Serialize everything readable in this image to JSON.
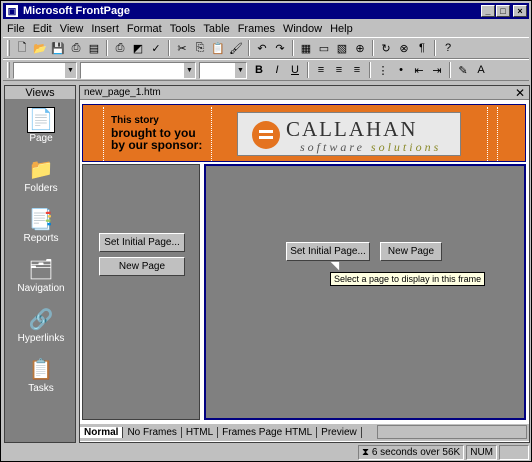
{
  "window": {
    "title": "Microsoft FrontPage"
  },
  "menu": [
    "File",
    "Edit",
    "View",
    "Insert",
    "Format",
    "Tools",
    "Table",
    "Frames",
    "Window",
    "Help"
  ],
  "views": {
    "header": "Views",
    "items": [
      {
        "label": "Page",
        "icon": "page-icon"
      },
      {
        "label": "Folders",
        "icon": "folder-icon"
      },
      {
        "label": "Reports",
        "icon": "reports-icon"
      },
      {
        "label": "Navigation",
        "icon": "navigation-icon"
      },
      {
        "label": "Hyperlinks",
        "icon": "hyperlinks-icon"
      },
      {
        "label": "Tasks",
        "icon": "tasks-icon"
      }
    ]
  },
  "document": {
    "filename": "new_page_1.htm",
    "banner": {
      "text_line1": "This story",
      "text_line2": "brought to you",
      "text_line3": "by our sponsor:",
      "logo_name": "CALLAHAN",
      "logo_sub1": "software",
      "logo_sub2": "solutions"
    },
    "left_frame": {
      "set_initial": "Set Initial Page...",
      "new_page": "New Page"
    },
    "right_frame": {
      "set_initial": "Set Initial Page...",
      "new_page": "New Page",
      "tooltip": "Select a page to display in this frame"
    },
    "tabs": [
      "Normal",
      "No Frames",
      "HTML",
      "Frames Page HTML",
      "Preview"
    ]
  },
  "status": {
    "timing": "6 seconds over 56K",
    "num": "NUM"
  }
}
